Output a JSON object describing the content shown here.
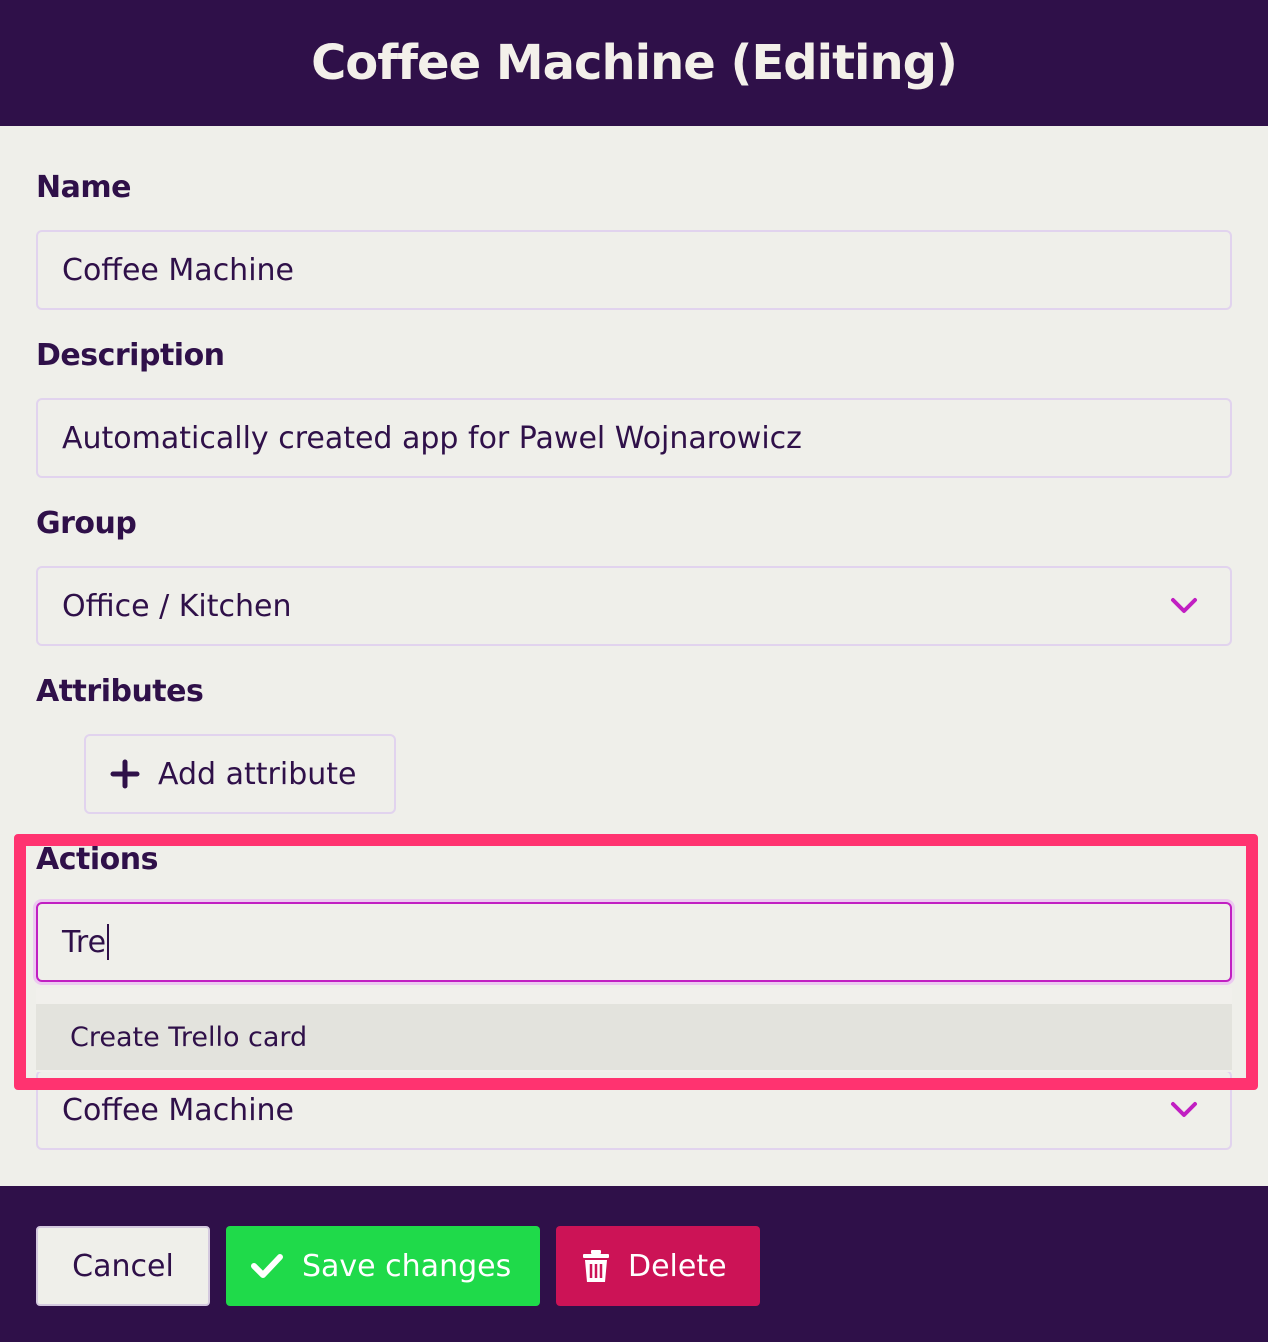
{
  "header": {
    "title": "Coffee Machine (Editing)"
  },
  "form": {
    "name_label": "Name",
    "name_value": "Coffee Machine",
    "description_label": "Description",
    "description_value": "Automatically created app for Pawel Wojnarowicz",
    "group_label": "Group",
    "group_value": "Office / Kitchen",
    "attributes_label": "Attributes",
    "add_attribute_label": "Add attribute",
    "actions_label": "Actions",
    "actions_input_value": "Tre",
    "actions_suggestions": [
      "Create Trello card"
    ],
    "hidden_select_value": "Coffee Machine"
  },
  "footer": {
    "cancel_label": "Cancel",
    "save_label": "Save changes",
    "delete_label": "Delete"
  },
  "colors": {
    "brand_dark": "#2f1049",
    "accent_purple": "#c11fc2",
    "save_green": "#1fda4a",
    "delete_red": "#cc1356",
    "highlight_pink": "#ff3370"
  },
  "icons": {
    "chevron": "chevron-down-icon",
    "plus": "plus-icon",
    "check": "check-icon",
    "trash": "trash-icon"
  }
}
